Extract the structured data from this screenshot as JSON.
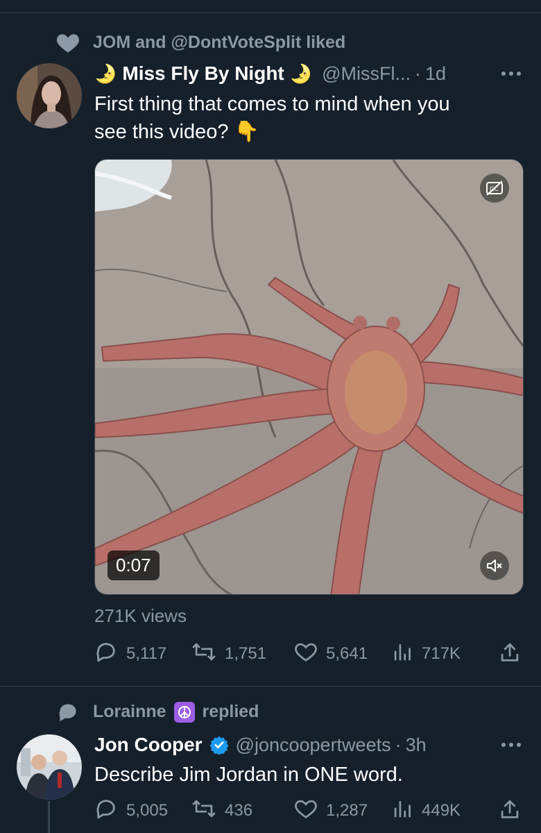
{
  "tweet1": {
    "social_context": "JOM and @DontVoteSplit liked",
    "display_name": "Miss Fly By Night",
    "name_prefix_emoji": "🌛",
    "name_suffix_emoji": "🌛",
    "handle": "@MissFl...",
    "time": "1d",
    "text_line1": "First thing that comes to mind when you",
    "text_line2": "see this video?",
    "text_emoji": "👇",
    "video_duration": "0:07",
    "views": "271K views",
    "replies": "5,117",
    "retweets": "1,751",
    "likes": "5,641",
    "view_count": "717K"
  },
  "tweet2": {
    "social_context_name": "Lorainne",
    "social_context_suffix": "replied",
    "display_name": "Jon Cooper",
    "handle": "@joncoopertweets",
    "time": "3h",
    "text": "Describe Jim Jordan in ONE word.",
    "replies": "5,005",
    "retweets": "436",
    "likes": "1,287",
    "view_count": "449K"
  },
  "colors": {
    "background": "#15202b",
    "secondary_text": "#8b98a5",
    "verified": "#1d9bf0",
    "divider": "#38444d"
  }
}
